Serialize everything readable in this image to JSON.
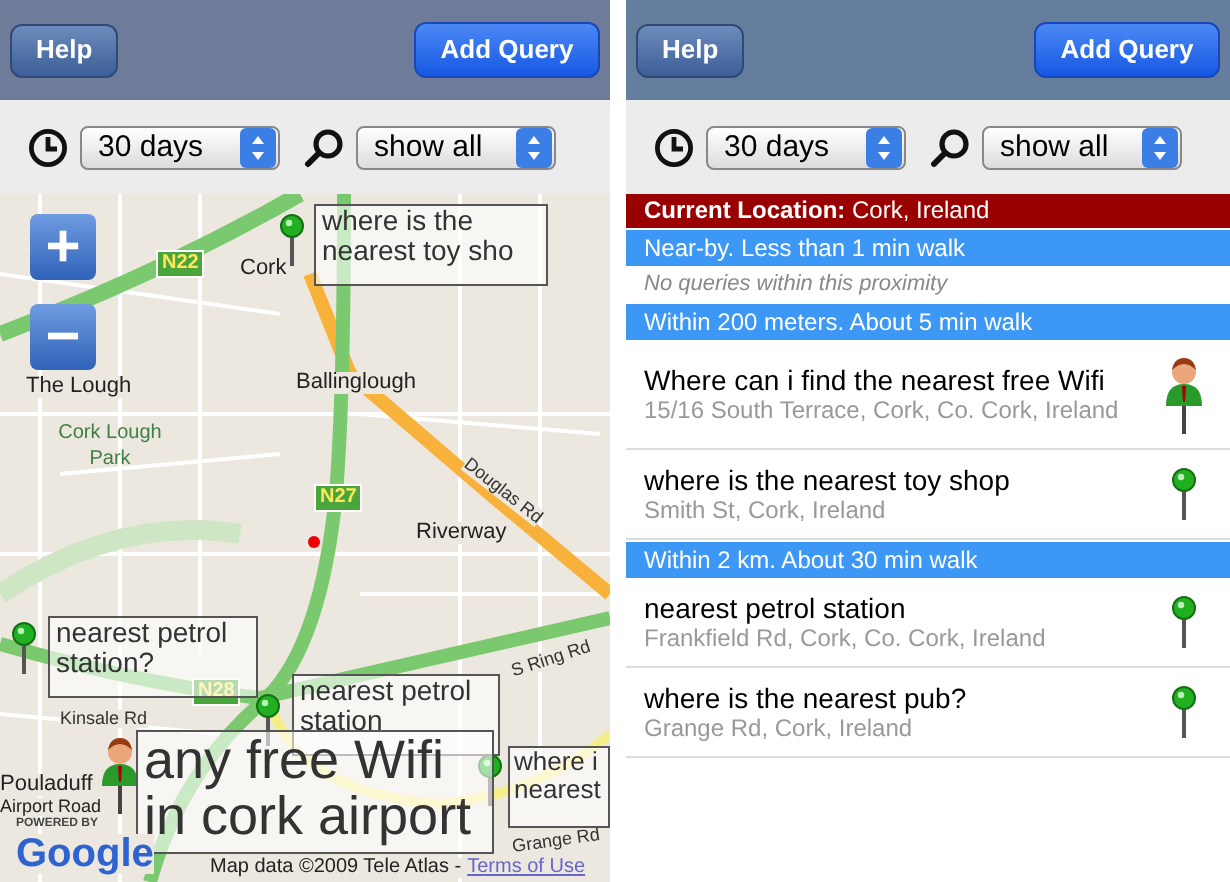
{
  "screens": [
    {
      "kind": "map",
      "top_bar": {
        "help": "Help",
        "add_query": "Add Query"
      },
      "filters": {
        "period": "30 days",
        "scope": "show all"
      },
      "map": {
        "zoom_in": "+",
        "zoom_out": "−",
        "labels": [
          {
            "kind": "place",
            "text": "Cork"
          },
          {
            "kind": "place",
            "text": "The Lough"
          },
          {
            "kind": "park",
            "text": "Cork Lough Park"
          },
          {
            "kind": "place",
            "text": "Ballinglough"
          },
          {
            "kind": "place",
            "text": "Riverway"
          },
          {
            "kind": "road",
            "text": "Douglas Rd"
          },
          {
            "kind": "shield",
            "text": "N22"
          },
          {
            "kind": "shield",
            "text": "N27"
          },
          {
            "kind": "shield",
            "text": "N28"
          },
          {
            "kind": "road",
            "text": "Kinsale Rd"
          },
          {
            "kind": "road",
            "text": "S Ring Rd"
          },
          {
            "kind": "road",
            "text": "Grange Rd"
          },
          {
            "kind": "place",
            "text": "Pouladuff"
          },
          {
            "kind": "place",
            "text": "Airport Road"
          }
        ],
        "callouts": [
          {
            "kind": "small",
            "text": "where is the nearest toy sho"
          },
          {
            "kind": "small",
            "text": "nearest petrol station?"
          },
          {
            "kind": "small",
            "text": "nearest petrol station"
          },
          {
            "kind": "large",
            "text": "any free Wifi in cork airport"
          },
          {
            "kind": "small",
            "text": "where i nearest"
          }
        ],
        "powered_by": "POWERED BY",
        "logo": "Google",
        "copyright": "Map data ©2009 Tele Atlas -",
        "terms": "Terms of Use"
      }
    },
    {
      "kind": "list",
      "top_bar": {
        "help": "Help",
        "add_query": "Add Query"
      },
      "filters": {
        "period": "30 days",
        "scope": "show all"
      },
      "rows": [
        {
          "kind": "location",
          "text": "**Current Location:** Cork, Ireland"
        },
        {
          "kind": "section",
          "text": "Near-by. Less than 1 min walk"
        },
        {
          "kind": "empty",
          "text": "No queries within this proximity"
        },
        {
          "kind": "section",
          "text": "Within 200 meters. About 5 min walk"
        },
        {
          "kind": "query",
          "title": "Where can i find the nearest free Wifi",
          "address": "15/16 South Terrace, Cork, Co. Cork, Ireland",
          "marker": {
            "kind": "person"
          }
        },
        {
          "kind": "query",
          "title": "where is the nearest toy shop",
          "address": "Smith St, Cork, Ireland",
          "marker": {
            "kind": "pin"
          }
        },
        {
          "kind": "section",
          "text": "Within 2 km. About 30 min walk"
        },
        {
          "kind": "query",
          "title": "nearest petrol station",
          "address": "Frankfield Rd, Cork, Co. Cork, Ireland",
          "marker": {
            "kind": "pin"
          }
        },
        {
          "kind": "query",
          "title": "where is the nearest pub?",
          "address": "Grange Rd, Cork, Ireland",
          "marker": {
            "kind": "pin"
          }
        }
      ]
    }
  ]
}
